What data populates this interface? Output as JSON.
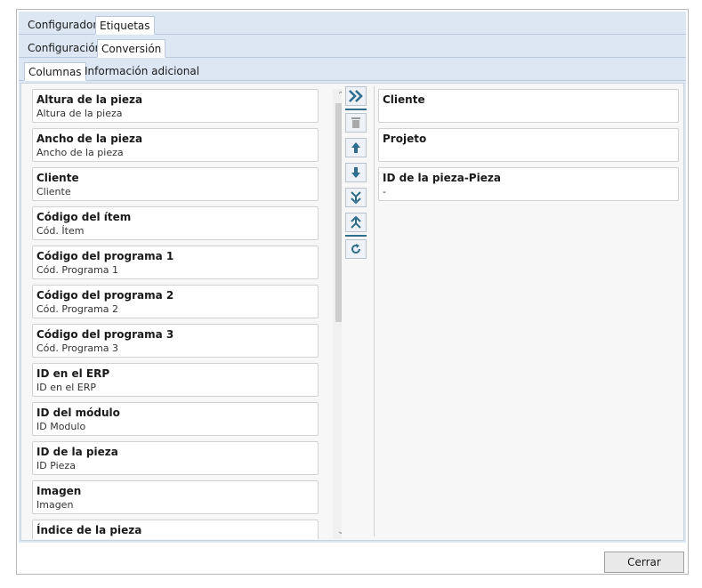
{
  "tabs_top": [
    "Configurador",
    "Etiquetas"
  ],
  "tabs_second": [
    "Configuración",
    "Conversión"
  ],
  "tabs_third": [
    "Columnas",
    "Información adicional"
  ],
  "available_fields": [
    {
      "title": "Altura de la pieza",
      "subtitle": "Altura de la pieza"
    },
    {
      "title": "Ancho de la pieza",
      "subtitle": "Ancho de la pieza"
    },
    {
      "title": "Cliente",
      "subtitle": "Cliente"
    },
    {
      "title": "Código del ítem",
      "subtitle": "Cód. Ítem"
    },
    {
      "title": "Código del programa 1",
      "subtitle": "Cód. Programa 1"
    },
    {
      "title": "Código del programa 2",
      "subtitle": "Cód. Programa 2"
    },
    {
      "title": "Código del programa 3",
      "subtitle": "Cód. Programa 3"
    },
    {
      "title": "ID en el ERP",
      "subtitle": "ID en el ERP"
    },
    {
      "title": "ID del módulo",
      "subtitle": "ID Modulo"
    },
    {
      "title": "ID de la pieza",
      "subtitle": "ID Pieza"
    },
    {
      "title": "Imagen",
      "subtitle": "Imagen"
    },
    {
      "title": "Índice de la pieza",
      "subtitle": ""
    }
  ],
  "selected_fields": [
    {
      "title": "Cliente",
      "subtitle": ""
    },
    {
      "title": "Projeto",
      "subtitle": ""
    },
    {
      "title": "ID de la pieza-Pieza",
      "subtitle": "-"
    }
  ],
  "toolbar_icons": [
    "move-all-right-icon",
    "delete-icon",
    "move-up-icon",
    "move-down-icon",
    "move-to-bottom-icon",
    "move-to-top-icon",
    "refresh-icon"
  ],
  "footer": {
    "close_label": "Cerrar"
  },
  "colors": {
    "tab_band": "#dce7f3",
    "icon_accent": "#2f6d8f"
  }
}
